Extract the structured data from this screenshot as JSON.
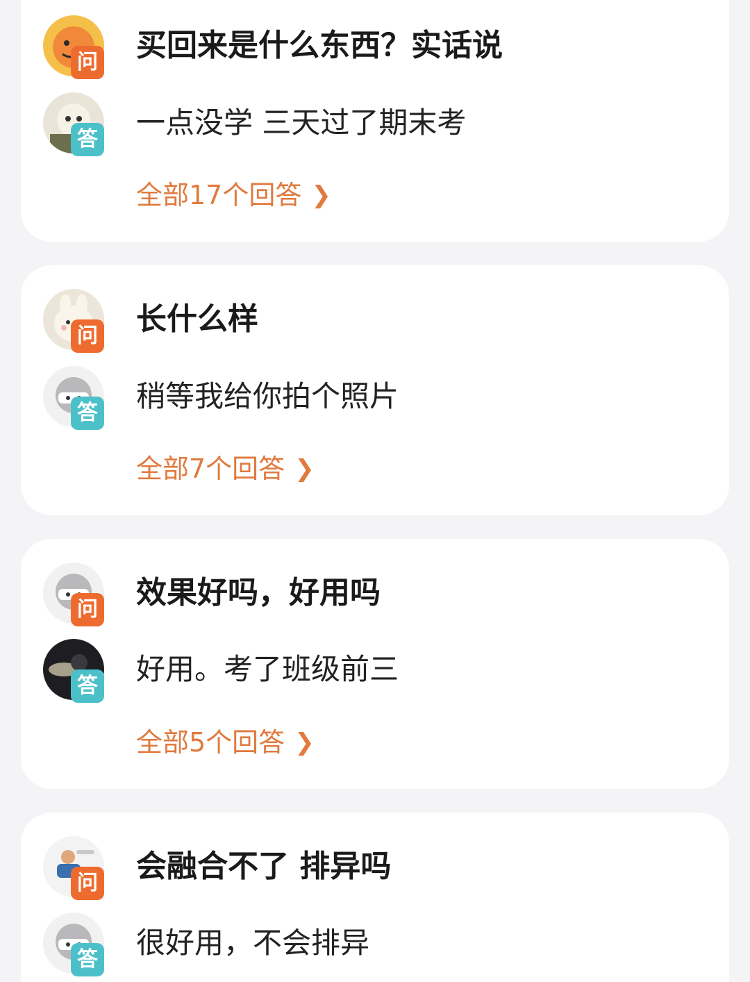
{
  "cards": [
    {
      "question": "买回来是什么东西？实话说",
      "answer": "一点没学 三天过了期末考",
      "more_label": "全部17个回答"
    },
    {
      "question": "长什么样",
      "answer": "稍等我给你拍个照片",
      "more_label": "全部7个回答"
    },
    {
      "question": "效果好吗，好用吗",
      "answer": "好用。考了班级前三",
      "more_label": "全部5个回答"
    },
    {
      "question": "会融合不了 排异吗",
      "answer": "很好用，不会排异",
      "more_label": ""
    }
  ],
  "badges": {
    "question": "问",
    "answer": "答"
  },
  "icons": {
    "chevron": "chevron-right-icon"
  },
  "colors": {
    "question_badge": "#ee6b2f",
    "answer_badge": "#4cc0c9",
    "link": "#e07a3e"
  }
}
